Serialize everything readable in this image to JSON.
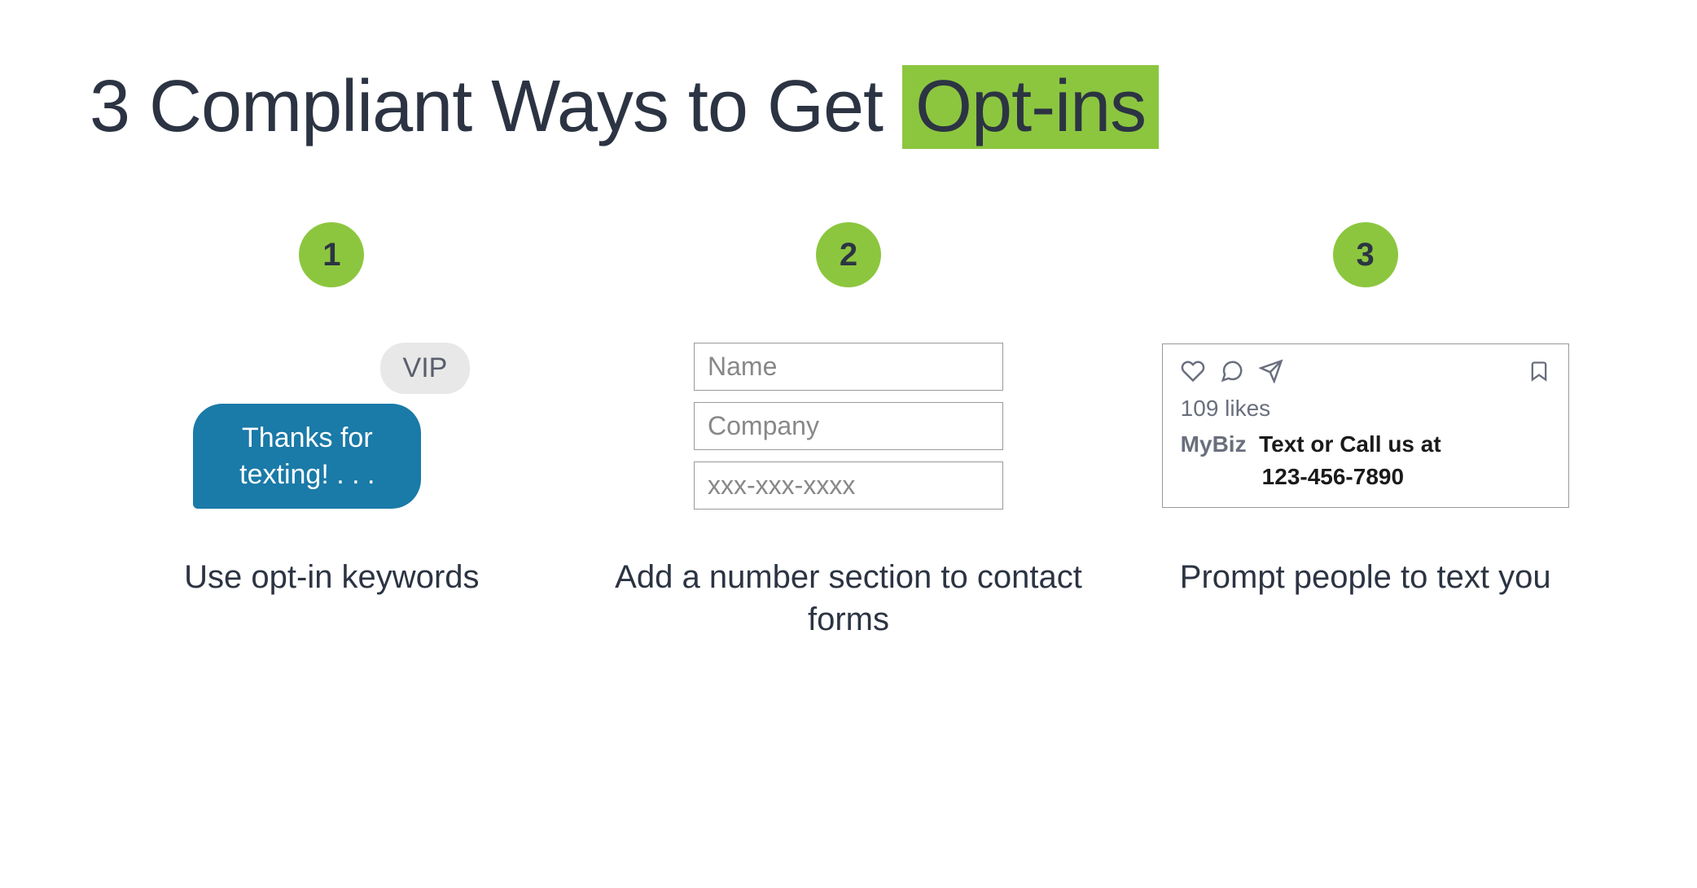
{
  "title": {
    "prefix": "3 Compliant Ways to Get ",
    "highlight": "Opt-ins"
  },
  "columns": [
    {
      "number": "1",
      "caption": "Use opt-in keywords",
      "chat": {
        "incoming": "VIP",
        "outgoing": "Thanks for texting! . . ."
      }
    },
    {
      "number": "2",
      "caption": "Add a number section to contact forms",
      "form_fields": [
        "Name",
        "Company",
        "xxx-xxx-xxxx"
      ]
    },
    {
      "number": "3",
      "caption": "Prompt people to text you",
      "social": {
        "likes": "109 likes",
        "handle": "MyBiz",
        "message": "Text or Call us at",
        "phone": "123-456-7890"
      }
    }
  ]
}
